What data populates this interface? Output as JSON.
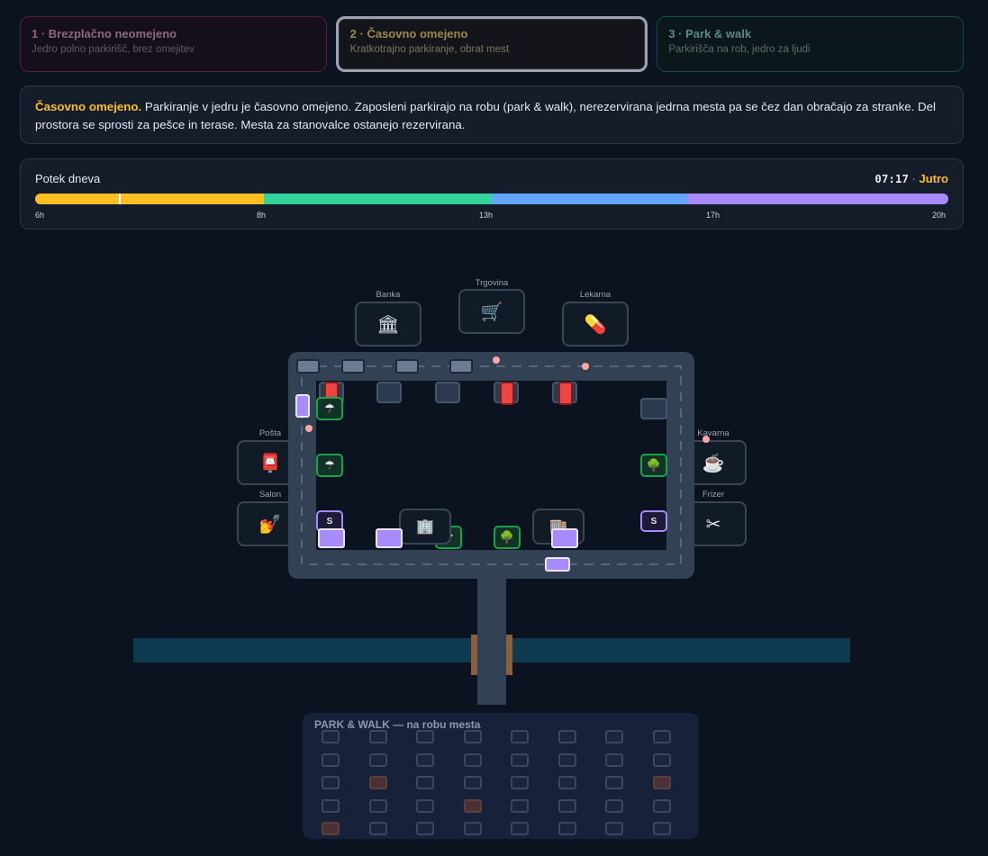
{
  "modes": [
    {
      "title": "1 · Brezplačno neomejeno",
      "subtitle": "Jedro polno parkirišč, brez omejitev"
    },
    {
      "title": "2 · Časovno omejeno",
      "subtitle": "Kratkotrajno parkiranje, obrat mest"
    },
    {
      "title": "3 · Park & walk",
      "subtitle": "Parkirišča na rob, jedro za ljudi"
    }
  ],
  "selected_mode": 1,
  "description": {
    "lead": "Časovno omejeno.",
    "text": " Parkiranje v jedru je časovno omejeno. Zaposleni parkirajo na robu (park & walk), nerezervirana jedrna mesta pa se čez dan obračajo za stranke. Del prostora se sprosti za pešce in terase. Mesta za stanovalce ostanejo rezervirana."
  },
  "timeline": {
    "title": "Potek dneva",
    "clock": "07:17",
    "separator": " · ",
    "phase": "Jutro",
    "progress": 0.092,
    "ticks": [
      "6h",
      "8h",
      "13h",
      "17h",
      "20h"
    ],
    "segments": [
      {
        "color": "#fbbf24",
        "from": 6,
        "to": 9.5
      },
      {
        "color": "#34d399",
        "from": 9.5,
        "to": 13
      },
      {
        "color": "#60a5fa",
        "from": 13,
        "to": 16
      },
      {
        "color": "#a78bfa",
        "from": 16,
        "to": 20
      }
    ]
  },
  "buildings": {
    "banka": {
      "label": "Banka",
      "icon": "bank-icon",
      "glyph": "🏛"
    },
    "trgovina": {
      "label": "Trgovina",
      "icon": "cart-icon",
      "glyph": "🛒"
    },
    "lekarna": {
      "label": "Lekarna",
      "icon": "pill-icon",
      "glyph": "💊"
    },
    "posta": {
      "label": "Pošta",
      "icon": "mailbox-icon",
      "glyph": "📮"
    },
    "salon": {
      "label": "Salon",
      "icon": "nail-polish-icon",
      "glyph": "💅"
    },
    "kavarna": {
      "label": "Kavarna",
      "icon": "coffee-icon",
      "glyph": "☕"
    },
    "frizer": {
      "label": "Frizer",
      "icon": "scissors-icon",
      "glyph": "✂"
    }
  },
  "reserved_label": "S",
  "park_walk": {
    "title": "PARK & WALK — na robu mesta",
    "rows": 5,
    "cols": 8,
    "occupied": [
      [
        2,
        1
      ],
      [
        2,
        7
      ],
      [
        3,
        3
      ],
      [
        4,
        0
      ]
    ]
  }
}
